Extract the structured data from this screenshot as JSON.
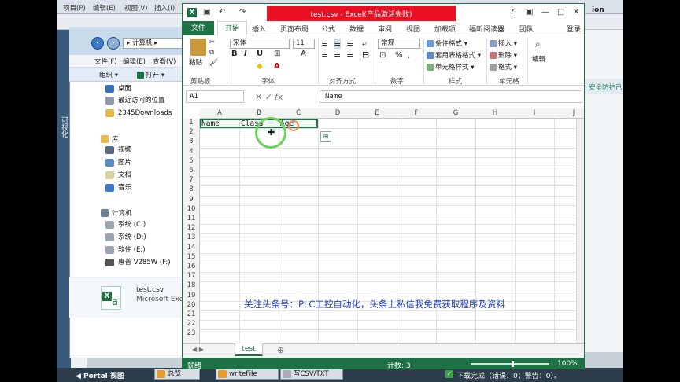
{
  "tia": {
    "menu": [
      "项目(P)",
      "编辑(E)",
      "视图(V)",
      "插入(I)"
    ],
    "left_label": "可视化",
    "top_right": "ion",
    "security": "安全防护已",
    "name_column": "名称",
    "portal": "◀ Portal 视图",
    "tasks": [
      "总览",
      "writeFile",
      "写CSV/TXT"
    ],
    "download_status": "下载完成（错误：0；警告：0）。"
  },
  "explorer": {
    "path": "▸ 计算机 ▸",
    "menu": [
      "文件(F)",
      "编辑(E)",
      "查看(V)"
    ],
    "cmd_organize": "组织 ▾",
    "cmd_open": "打开 ▾",
    "favorites": [
      "桌面",
      "最近访问的位置",
      "2345Downloads"
    ],
    "library_header": "库",
    "libraries": [
      "视频",
      "图片",
      "文档",
      "音乐"
    ],
    "computer_header": "计算机",
    "drives": [
      "系统 (C:)",
      "系统 (D:)",
      "软件 (E:)",
      "惠普 V285W (F:)"
    ],
    "file_name": "test.csv",
    "file_app": "Microsoft Excel"
  },
  "excel": {
    "title": "test.csv - Excel(产品激活失败)",
    "file_tab": "文件",
    "tabs": [
      "开始",
      "插入",
      "页面布局",
      "公式",
      "数据",
      "审阅",
      "视图",
      "加载项",
      "福昕阅读器",
      "团队"
    ],
    "login": "登录",
    "ribbon": {
      "paste": "粘贴",
      "font_name": "宋体",
      "font_size": "11",
      "number_format": "常规",
      "cond_format": "条件格式 ▾",
      "table_format": "套用表格格式 ▾",
      "cell_style": "单元格样式 ▾",
      "insert": "插入 ▾",
      "delete": "删除 ▾",
      "format": "格式 ▾",
      "edit": "编辑",
      "groups": [
        "剪贴板",
        "字体",
        "对齐方式",
        "数字",
        "样式",
        "单元格"
      ]
    },
    "namebox": "A1",
    "formula": "Name",
    "columns": [
      "A",
      "B",
      "C",
      "D",
      "E",
      "F",
      "G",
      "H",
      "I",
      "J"
    ],
    "rows": [
      "1",
      "2",
      "3",
      "4",
      "5",
      "6",
      "7",
      "8",
      "9",
      "10",
      "11",
      "12",
      "13",
      "14",
      "15",
      "16",
      "17",
      "18",
      "19",
      "20",
      "21",
      "22",
      "23"
    ],
    "cells": [
      "Name",
      "Class",
      "Age"
    ],
    "sheet": "test",
    "status_ready": "就绪",
    "status_count": "计数: 3",
    "zoom": "100%"
  },
  "watermark": "关注头条号：PLC工控自动化，头条上私信我免费获取程序及资料",
  "colors": {
    "excel_green": "#1d7144",
    "title_red": "#e81123"
  }
}
